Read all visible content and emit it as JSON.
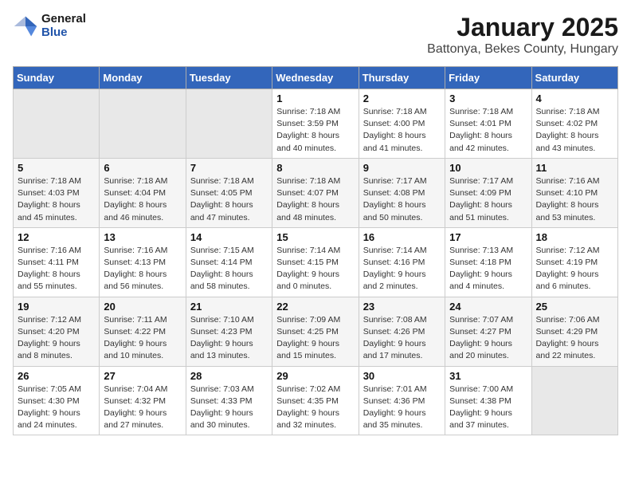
{
  "logo": {
    "general": "General",
    "blue": "Blue"
  },
  "header": {
    "month": "January 2025",
    "location": "Battonya, Bekes County, Hungary"
  },
  "weekdays": [
    "Sunday",
    "Monday",
    "Tuesday",
    "Wednesday",
    "Thursday",
    "Friday",
    "Saturday"
  ],
  "weeks": [
    [
      {
        "day": "",
        "sunrise": "",
        "sunset": "",
        "daylight": ""
      },
      {
        "day": "",
        "sunrise": "",
        "sunset": "",
        "daylight": ""
      },
      {
        "day": "",
        "sunrise": "",
        "sunset": "",
        "daylight": ""
      },
      {
        "day": "1",
        "sunrise": "Sunrise: 7:18 AM",
        "sunset": "Sunset: 3:59 PM",
        "daylight": "Daylight: 8 hours and 40 minutes."
      },
      {
        "day": "2",
        "sunrise": "Sunrise: 7:18 AM",
        "sunset": "Sunset: 4:00 PM",
        "daylight": "Daylight: 8 hours and 41 minutes."
      },
      {
        "day": "3",
        "sunrise": "Sunrise: 7:18 AM",
        "sunset": "Sunset: 4:01 PM",
        "daylight": "Daylight: 8 hours and 42 minutes."
      },
      {
        "day": "4",
        "sunrise": "Sunrise: 7:18 AM",
        "sunset": "Sunset: 4:02 PM",
        "daylight": "Daylight: 8 hours and 43 minutes."
      }
    ],
    [
      {
        "day": "5",
        "sunrise": "Sunrise: 7:18 AM",
        "sunset": "Sunset: 4:03 PM",
        "daylight": "Daylight: 8 hours and 45 minutes."
      },
      {
        "day": "6",
        "sunrise": "Sunrise: 7:18 AM",
        "sunset": "Sunset: 4:04 PM",
        "daylight": "Daylight: 8 hours and 46 minutes."
      },
      {
        "day": "7",
        "sunrise": "Sunrise: 7:18 AM",
        "sunset": "Sunset: 4:05 PM",
        "daylight": "Daylight: 8 hours and 47 minutes."
      },
      {
        "day": "8",
        "sunrise": "Sunrise: 7:18 AM",
        "sunset": "Sunset: 4:07 PM",
        "daylight": "Daylight: 8 hours and 48 minutes."
      },
      {
        "day": "9",
        "sunrise": "Sunrise: 7:17 AM",
        "sunset": "Sunset: 4:08 PM",
        "daylight": "Daylight: 8 hours and 50 minutes."
      },
      {
        "day": "10",
        "sunrise": "Sunrise: 7:17 AM",
        "sunset": "Sunset: 4:09 PM",
        "daylight": "Daylight: 8 hours and 51 minutes."
      },
      {
        "day": "11",
        "sunrise": "Sunrise: 7:16 AM",
        "sunset": "Sunset: 4:10 PM",
        "daylight": "Daylight: 8 hours and 53 minutes."
      }
    ],
    [
      {
        "day": "12",
        "sunrise": "Sunrise: 7:16 AM",
        "sunset": "Sunset: 4:11 PM",
        "daylight": "Daylight: 8 hours and 55 minutes."
      },
      {
        "day": "13",
        "sunrise": "Sunrise: 7:16 AM",
        "sunset": "Sunset: 4:13 PM",
        "daylight": "Daylight: 8 hours and 56 minutes."
      },
      {
        "day": "14",
        "sunrise": "Sunrise: 7:15 AM",
        "sunset": "Sunset: 4:14 PM",
        "daylight": "Daylight: 8 hours and 58 minutes."
      },
      {
        "day": "15",
        "sunrise": "Sunrise: 7:14 AM",
        "sunset": "Sunset: 4:15 PM",
        "daylight": "Daylight: 9 hours and 0 minutes."
      },
      {
        "day": "16",
        "sunrise": "Sunrise: 7:14 AM",
        "sunset": "Sunset: 4:16 PM",
        "daylight": "Daylight: 9 hours and 2 minutes."
      },
      {
        "day": "17",
        "sunrise": "Sunrise: 7:13 AM",
        "sunset": "Sunset: 4:18 PM",
        "daylight": "Daylight: 9 hours and 4 minutes."
      },
      {
        "day": "18",
        "sunrise": "Sunrise: 7:12 AM",
        "sunset": "Sunset: 4:19 PM",
        "daylight": "Daylight: 9 hours and 6 minutes."
      }
    ],
    [
      {
        "day": "19",
        "sunrise": "Sunrise: 7:12 AM",
        "sunset": "Sunset: 4:20 PM",
        "daylight": "Daylight: 9 hours and 8 minutes."
      },
      {
        "day": "20",
        "sunrise": "Sunrise: 7:11 AM",
        "sunset": "Sunset: 4:22 PM",
        "daylight": "Daylight: 9 hours and 10 minutes."
      },
      {
        "day": "21",
        "sunrise": "Sunrise: 7:10 AM",
        "sunset": "Sunset: 4:23 PM",
        "daylight": "Daylight: 9 hours and 13 minutes."
      },
      {
        "day": "22",
        "sunrise": "Sunrise: 7:09 AM",
        "sunset": "Sunset: 4:25 PM",
        "daylight": "Daylight: 9 hours and 15 minutes."
      },
      {
        "day": "23",
        "sunrise": "Sunrise: 7:08 AM",
        "sunset": "Sunset: 4:26 PM",
        "daylight": "Daylight: 9 hours and 17 minutes."
      },
      {
        "day": "24",
        "sunrise": "Sunrise: 7:07 AM",
        "sunset": "Sunset: 4:27 PM",
        "daylight": "Daylight: 9 hours and 20 minutes."
      },
      {
        "day": "25",
        "sunrise": "Sunrise: 7:06 AM",
        "sunset": "Sunset: 4:29 PM",
        "daylight": "Daylight: 9 hours and 22 minutes."
      }
    ],
    [
      {
        "day": "26",
        "sunrise": "Sunrise: 7:05 AM",
        "sunset": "Sunset: 4:30 PM",
        "daylight": "Daylight: 9 hours and 24 minutes."
      },
      {
        "day": "27",
        "sunrise": "Sunrise: 7:04 AM",
        "sunset": "Sunset: 4:32 PM",
        "daylight": "Daylight: 9 hours and 27 minutes."
      },
      {
        "day": "28",
        "sunrise": "Sunrise: 7:03 AM",
        "sunset": "Sunset: 4:33 PM",
        "daylight": "Daylight: 9 hours and 30 minutes."
      },
      {
        "day": "29",
        "sunrise": "Sunrise: 7:02 AM",
        "sunset": "Sunset: 4:35 PM",
        "daylight": "Daylight: 9 hours and 32 minutes."
      },
      {
        "day": "30",
        "sunrise": "Sunrise: 7:01 AM",
        "sunset": "Sunset: 4:36 PM",
        "daylight": "Daylight: 9 hours and 35 minutes."
      },
      {
        "day": "31",
        "sunrise": "Sunrise: 7:00 AM",
        "sunset": "Sunset: 4:38 PM",
        "daylight": "Daylight: 9 hours and 37 minutes."
      },
      {
        "day": "",
        "sunrise": "",
        "sunset": "",
        "daylight": ""
      }
    ]
  ]
}
